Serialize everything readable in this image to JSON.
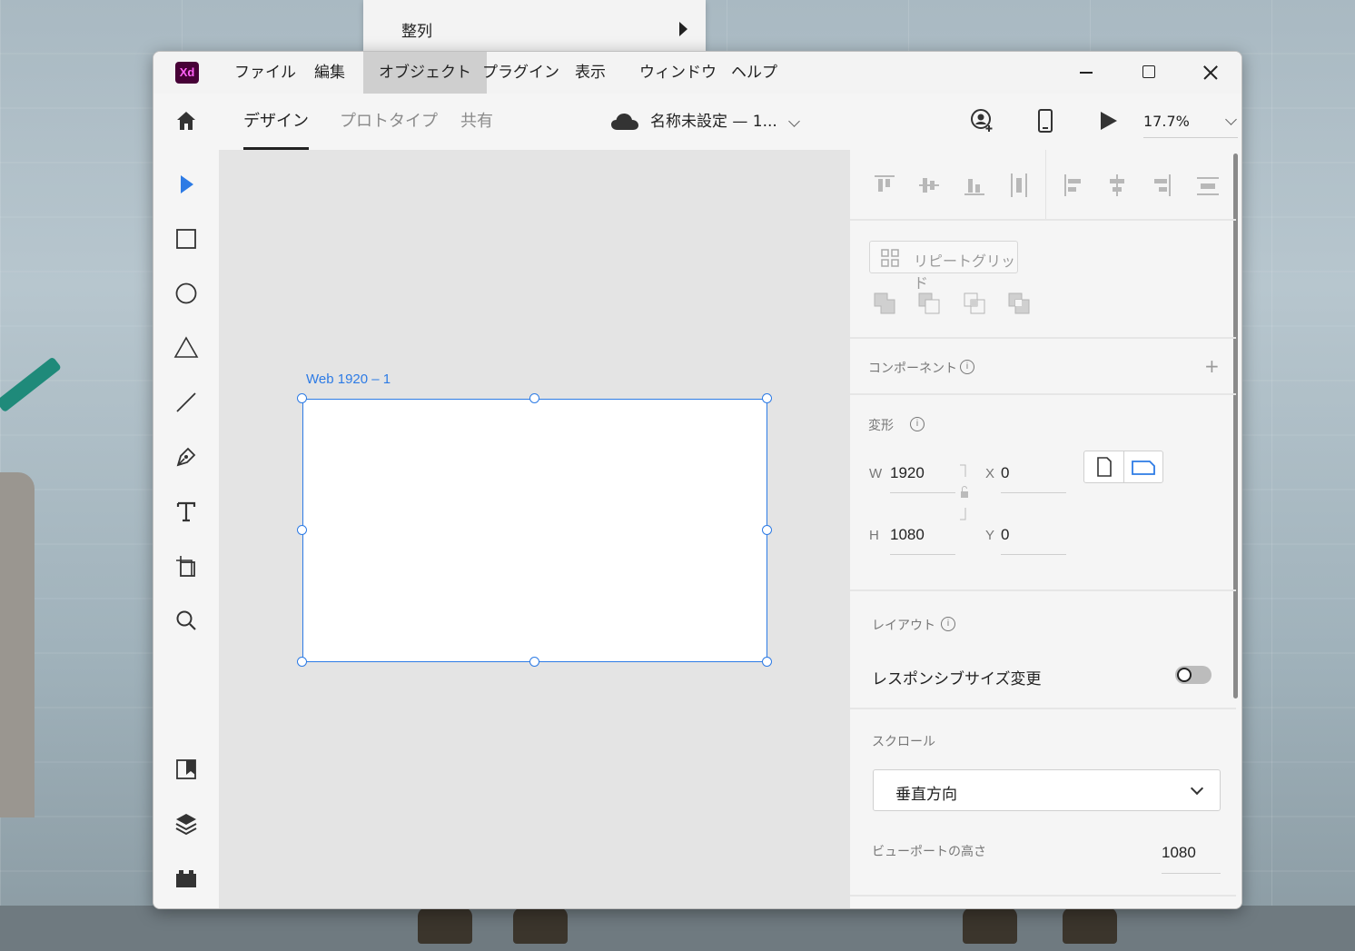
{
  "submenu": {
    "label": "整列"
  },
  "app": {
    "logo_text": "Xd"
  },
  "menu": {
    "items": [
      "ファイル",
      "編集",
      "オブジェクト",
      "プラグイン",
      "表示",
      "ウィンドウ",
      "ヘルプ"
    ],
    "active": "オブジェクト"
  },
  "tabs": [
    "デザイン",
    "プロトタイプ",
    "共有"
  ],
  "document": {
    "title": "名称未設定 — 1..."
  },
  "zoom": {
    "value": "17.7%"
  },
  "artboard": {
    "label": "Web 1920 – 1"
  },
  "panel": {
    "repeat_grid": "リピートグリッド",
    "components": {
      "title": "コンポーネント",
      "add": "+"
    },
    "transform": {
      "title": "変形",
      "w_label": "W",
      "w_value": "1920",
      "h_label": "H",
      "h_value": "1080",
      "x_label": "X",
      "x_value": "0",
      "y_label": "Y",
      "y_value": "0"
    },
    "layout": {
      "title": "レイアウト",
      "responsive_label": "レスポンシブサイズ変更",
      "responsive_on": false
    },
    "scroll": {
      "title": "スクロール",
      "direction": "垂直方向",
      "viewport_label": "ビューポートの高さ",
      "viewport_value": "1080"
    },
    "info_glyph": "i"
  },
  "colors": {
    "accent": "#2d7be5",
    "xd_bg": "#470137",
    "xd_fg": "#ff61f6"
  }
}
